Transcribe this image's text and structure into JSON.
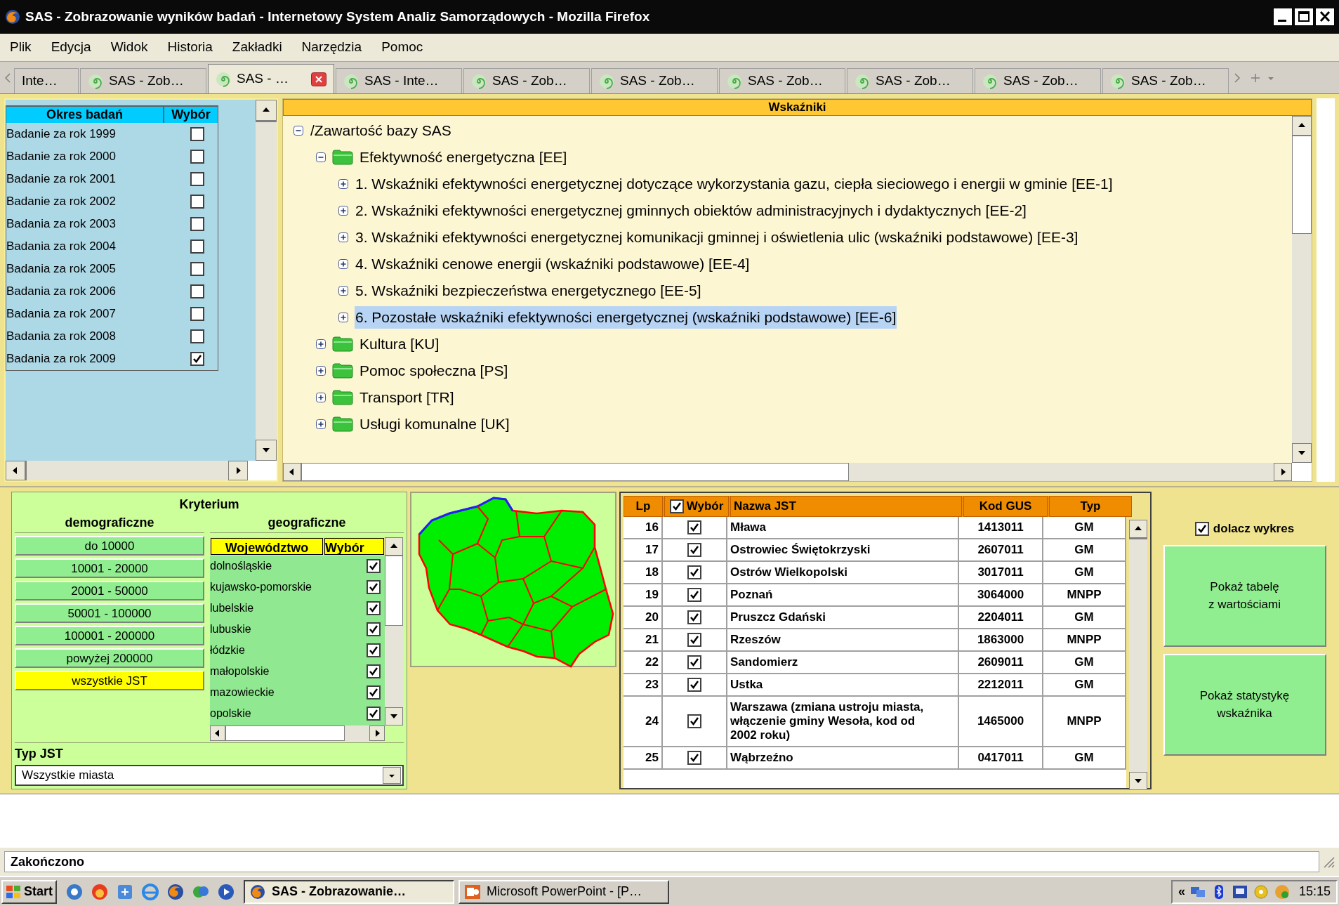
{
  "window": {
    "title": "SAS - Zobrazowanie wyników badań - Internetowy System Analiz Samorządowych - Mozilla Firefox"
  },
  "menu": [
    "Plik",
    "Edycja",
    "Widok",
    "Historia",
    "Zakładki",
    "Narzędzia",
    "Pomoc"
  ],
  "tabs": [
    {
      "label": "Inte…",
      "selected": false
    },
    {
      "label": "SAS - Zob…",
      "selected": false
    },
    {
      "label": "SAS - …",
      "selected": true
    },
    {
      "label": "SAS - Inte…",
      "selected": false
    },
    {
      "label": "SAS - Zob…",
      "selected": false
    },
    {
      "label": "SAS - Zob…",
      "selected": false
    },
    {
      "label": "SAS - Zob…",
      "selected": false
    },
    {
      "label": "SAS - Zob…",
      "selected": false
    },
    {
      "label": "SAS - Zob…",
      "selected": false
    },
    {
      "label": "SAS - Zob…",
      "selected": false
    }
  ],
  "periods": {
    "columns": [
      "Okres badań",
      "Wybór"
    ],
    "rows": [
      {
        "label": "Badanie za rok 1999",
        "checked": false
      },
      {
        "label": "Badanie za rok 2000",
        "checked": false
      },
      {
        "label": "Badanie za rok 2001",
        "checked": false
      },
      {
        "label": "Badanie za rok 2002",
        "checked": false
      },
      {
        "label": "Badania za rok 2003",
        "checked": false
      },
      {
        "label": "Badania za rok 2004",
        "checked": false
      },
      {
        "label": "Badania za rok 2005",
        "checked": false
      },
      {
        "label": "Badania za rok 2006",
        "checked": false
      },
      {
        "label": "Badania za rok 2007",
        "checked": false
      },
      {
        "label": "Badania za rok 2008",
        "checked": false
      },
      {
        "label": "Badania za rok 2009",
        "checked": true
      }
    ]
  },
  "indicators": {
    "title": "Wskaźniki",
    "tree": [
      {
        "folder": false,
        "label": "/Zawartość bazy SAS",
        "expanded": true,
        "selected": false,
        "children": [
          {
            "folder": true,
            "label": "Efektywność energetyczna [EE]",
            "expanded": true,
            "selected": false,
            "children": [
              {
                "folder": false,
                "label": "1. Wskaźniki efektywności energetycznej dotyczące wykorzystania gazu, ciepła sieciowego i energii w gminie [EE-1]",
                "expanded": false,
                "selected": false
              },
              {
                "folder": false,
                "label": "2. Wskaźniki efektywności energetycznej gminnych obiektów administracyjnych i dydaktycznych [EE-2]",
                "expanded": false,
                "selected": false
              },
              {
                "folder": false,
                "label": "3. Wskaźniki efektywności energetycznej komunikacji gminnej i oświetlenia ulic (wskaźniki podstawowe) [EE-3]",
                "expanded": false,
                "selected": false
              },
              {
                "folder": false,
                "label": "4. Wskaźniki cenowe energii (wskaźniki podstawowe) [EE-4]",
                "expanded": false,
                "selected": false
              },
              {
                "folder": false,
                "label": "5. Wskaźniki bezpieczeństwa energetycznego [EE-5]",
                "expanded": false,
                "selected": false
              },
              {
                "folder": false,
                "label": "6. Pozostałe wskaźniki efektywności energetycznej (wskaźniki podstawowe) [EE-6]",
                "expanded": false,
                "selected": true
              }
            ]
          },
          {
            "folder": true,
            "label": "Kultura [KU]",
            "expanded": false,
            "selected": false
          },
          {
            "folder": true,
            "label": "Pomoc społeczna [PS]",
            "expanded": false,
            "selected": false
          },
          {
            "folder": true,
            "label": "Transport [TR]",
            "expanded": false,
            "selected": false
          },
          {
            "folder": true,
            "label": "Usługi komunalne [UK]",
            "expanded": false,
            "selected": false
          }
        ]
      }
    ]
  },
  "criteria": {
    "title": "Kryterium",
    "demographic": {
      "title": "demograficzne",
      "options": [
        {
          "label": "do 10000",
          "selected": false
        },
        {
          "label": "10001 - 20000",
          "selected": false
        },
        {
          "label": "20001 - 50000",
          "selected": false
        },
        {
          "label": "50001 - 100000",
          "selected": false
        },
        {
          "label": "100001 - 200000",
          "selected": false
        },
        {
          "label": "powyżej 200000",
          "selected": false
        },
        {
          "label": "wszystkie JST",
          "selected": true
        }
      ]
    },
    "geographic": {
      "title": "geograficzne",
      "columns": [
        "Województwo",
        "Wybór"
      ],
      "rows": [
        {
          "label": "dolnośląskie",
          "checked": true
        },
        {
          "label": "kujawsko-pomorskie",
          "checked": true
        },
        {
          "label": "lubelskie",
          "checked": true
        },
        {
          "label": "lubuskie",
          "checked": true
        },
        {
          "label": "łódzkie",
          "checked": true
        },
        {
          "label": "małopolskie",
          "checked": true
        },
        {
          "label": "mazowieckie",
          "checked": true
        },
        {
          "label": "opolskie",
          "checked": true
        }
      ]
    },
    "type": {
      "label": "Typ JST",
      "value": "Wszystkie miasta"
    }
  },
  "table": {
    "columns": [
      "Lp",
      "Wybór",
      "Nazwa JST",
      "Kod GUS",
      "Typ"
    ],
    "header_checked": true,
    "rows": [
      {
        "lp": "16",
        "checked": true,
        "name": "Mława",
        "code": "1413011",
        "type": "GM"
      },
      {
        "lp": "17",
        "checked": true,
        "name": "Ostrowiec Świętokrzyski",
        "code": "2607011",
        "type": "GM"
      },
      {
        "lp": "18",
        "checked": true,
        "name": "Ostrów Wielkopolski",
        "code": "3017011",
        "type": "GM"
      },
      {
        "lp": "19",
        "checked": true,
        "name": "Poznań",
        "code": "3064000",
        "type": "MNPP"
      },
      {
        "lp": "20",
        "checked": true,
        "name": "Pruszcz Gdański",
        "code": "2204011",
        "type": "GM"
      },
      {
        "lp": "21",
        "checked": true,
        "name": "Rzeszów",
        "code": "1863000",
        "type": "MNPP"
      },
      {
        "lp": "22",
        "checked": true,
        "name": "Sandomierz",
        "code": "2609011",
        "type": "GM"
      },
      {
        "lp": "23",
        "checked": true,
        "name": "Ustka",
        "code": "2212011",
        "type": "GM"
      },
      {
        "lp": "24",
        "checked": true,
        "name": "Warszawa (zmiana ustroju miasta, włączenie gminy Wesoła, kod od 2002 roku)",
        "code": "1465000",
        "type": "MNPP"
      },
      {
        "lp": "25",
        "checked": true,
        "name": "Wąbrzeźno",
        "code": "0417011",
        "type": "GM"
      }
    ]
  },
  "actions": {
    "attach_chart": {
      "label": "dolacz wykres",
      "checked": true
    },
    "buttons": [
      "Pokaż tabelę\nz wartościami",
      "Pokaż statystykę\nwskaźnika"
    ]
  },
  "status_bar": {
    "text": "Zakończono"
  },
  "taskbar": {
    "start": "Start",
    "tasks": [
      {
        "label": "SAS - Zobrazowanie…",
        "selected": true
      },
      {
        "label": "Microsoft PowerPoint - [P…",
        "selected": false
      }
    ],
    "tray_toggle": "«",
    "clock": "15:15"
  }
}
